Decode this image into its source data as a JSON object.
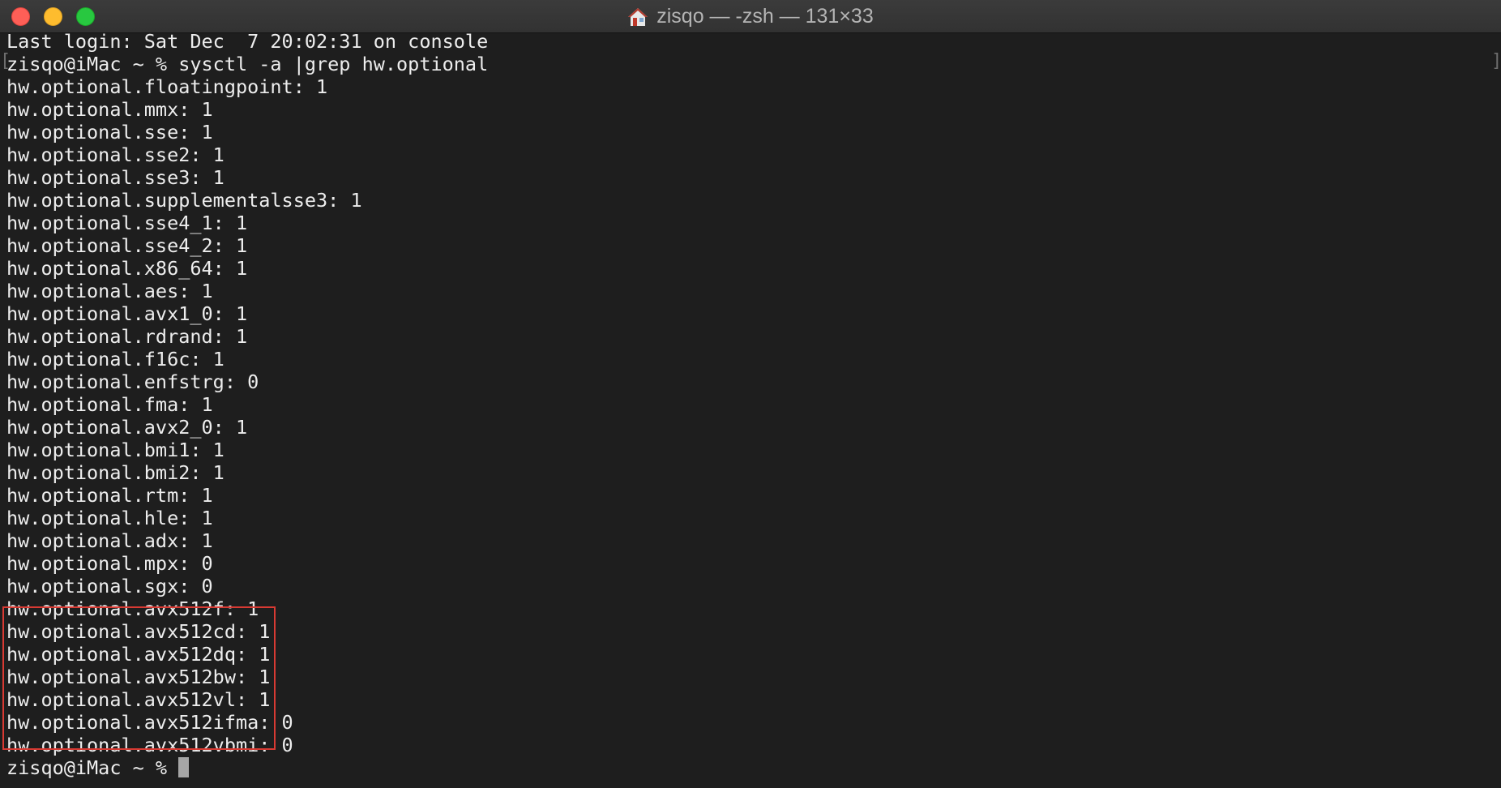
{
  "window": {
    "title": "zisqo — -zsh — 131×33",
    "title_icon": "home-icon",
    "controls": [
      "close",
      "minimize",
      "zoom"
    ]
  },
  "terminal": {
    "lines": [
      "Last login: Sat Dec  7 20:02:31 on console",
      "zisqo@iMac ~ % sysctl -a |grep hw.optional",
      "hw.optional.floatingpoint: 1",
      "hw.optional.mmx: 1",
      "hw.optional.sse: 1",
      "hw.optional.sse2: 1",
      "hw.optional.sse3: 1",
      "hw.optional.supplementalsse3: 1",
      "hw.optional.sse4_1: 1",
      "hw.optional.sse4_2: 1",
      "hw.optional.x86_64: 1",
      "hw.optional.aes: 1",
      "hw.optional.avx1_0: 1",
      "hw.optional.rdrand: 1",
      "hw.optional.f16c: 1",
      "hw.optional.enfstrg: 0",
      "hw.optional.fma: 1",
      "hw.optional.avx2_0: 1",
      "hw.optional.bmi1: 1",
      "hw.optional.bmi2: 1",
      "hw.optional.rtm: 1",
      "hw.optional.hle: 1",
      "hw.optional.adx: 1",
      "hw.optional.mpx: 0",
      "hw.optional.sgx: 0",
      "hw.optional.avx512f: 1",
      "hw.optional.avx512cd: 1",
      "hw.optional.avx512dq: 1",
      "hw.optional.avx512bw: 1",
      "hw.optional.avx512vl: 1",
      "hw.optional.avx512ifma: 0",
      "hw.optional.avx512vbmi: 0",
      "zisqo@iMac ~ % "
    ],
    "command_brackets": {
      "left": "[",
      "right": "]"
    },
    "highlight_color": "#d83a33"
  }
}
